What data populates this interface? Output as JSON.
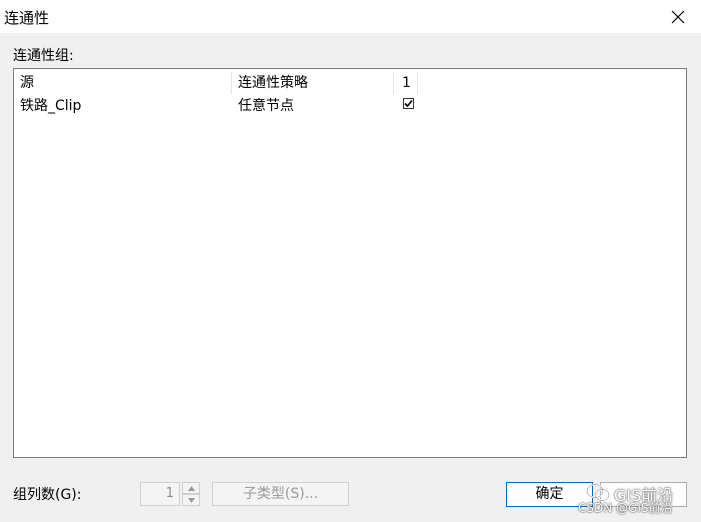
{
  "window": {
    "title": "连通性"
  },
  "group_label": "连通性组:",
  "table": {
    "headers": [
      "源",
      "连通性策略",
      "1"
    ],
    "rows": [
      {
        "source": "铁路_Clip",
        "policy": "任意节点",
        "checked": true
      }
    ]
  },
  "footer": {
    "count_label": "组列数(G):",
    "count_value": "1",
    "subtype_label": "子类型(S)...",
    "ok_label": "确定",
    "cancel_label": ""
  },
  "watermark": {
    "title": "GIS前沿",
    "subtitle": "CSDN @GIS前沿"
  },
  "colors": {
    "accent": "#0067c0",
    "background": "#f0f0f0",
    "titlebar": "#ffffff"
  }
}
